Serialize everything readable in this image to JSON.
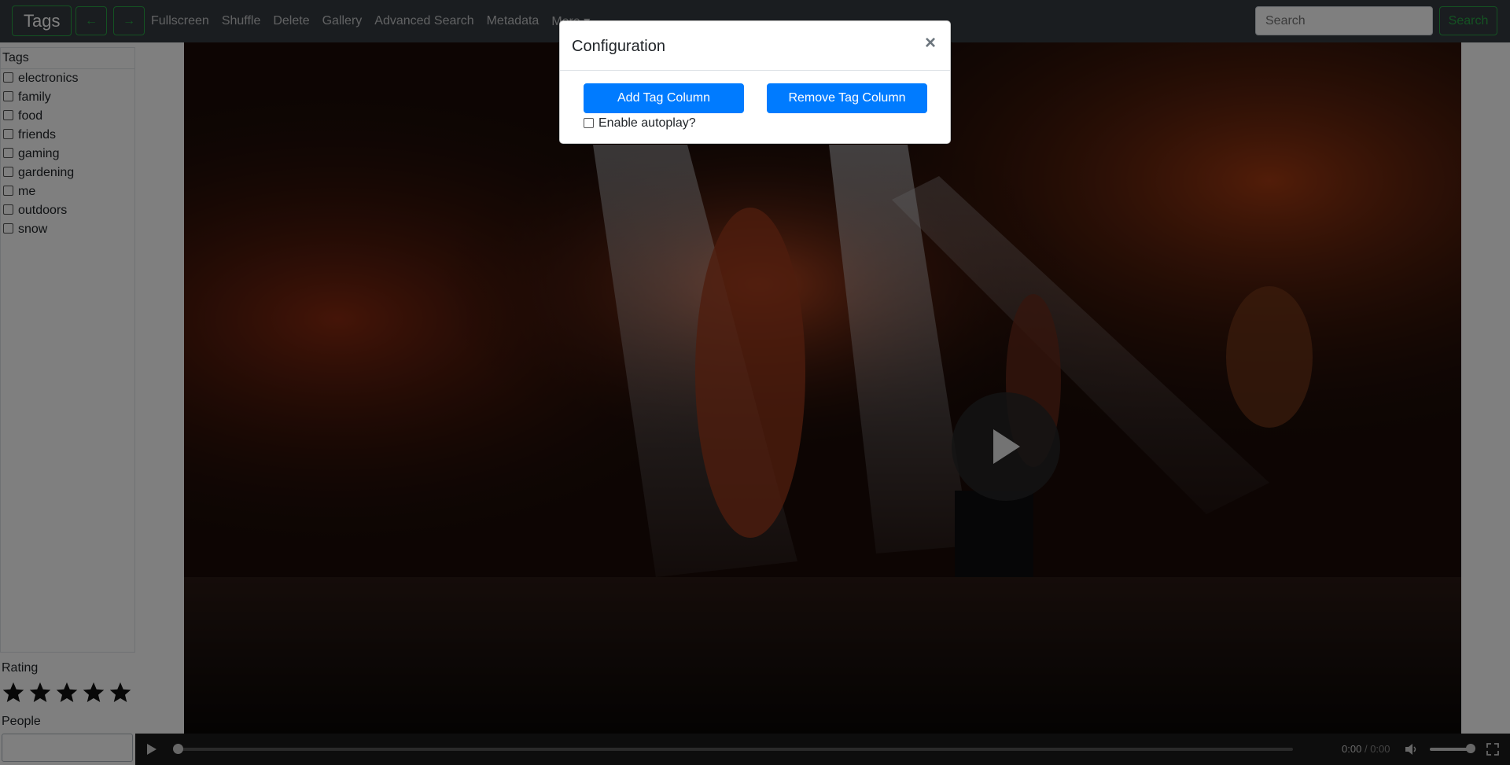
{
  "navbar": {
    "brand": "Tags",
    "back_arrow": "←",
    "forward_arrow": "→",
    "links": [
      "Fullscreen",
      "Shuffle",
      "Delete",
      "Gallery",
      "Advanced Search",
      "Metadata",
      "More"
    ],
    "more_caret": "▾",
    "search_placeholder": "Search",
    "search_button": "Search",
    "accent_color": "#28a745"
  },
  "sidebar": {
    "tags_header": "Tags",
    "tags": [
      "electronics",
      "family",
      "food",
      "friends",
      "gaming",
      "gardening",
      "me",
      "outdoors",
      "snow"
    ],
    "rating_label": "Rating",
    "rating_stars": 5,
    "people_label": "People"
  },
  "player": {
    "current_time": "0:00",
    "separator": "/",
    "duration": "0:00",
    "progress": 0,
    "volume": 1.0
  },
  "modal": {
    "title": "Configuration",
    "close_symbol": "×",
    "add_button": "Add Tag Column",
    "remove_button": "Remove Tag Column",
    "autoplay_label": "Enable autoplay?",
    "autoplay_checked": false,
    "button_color": "#007bff"
  }
}
